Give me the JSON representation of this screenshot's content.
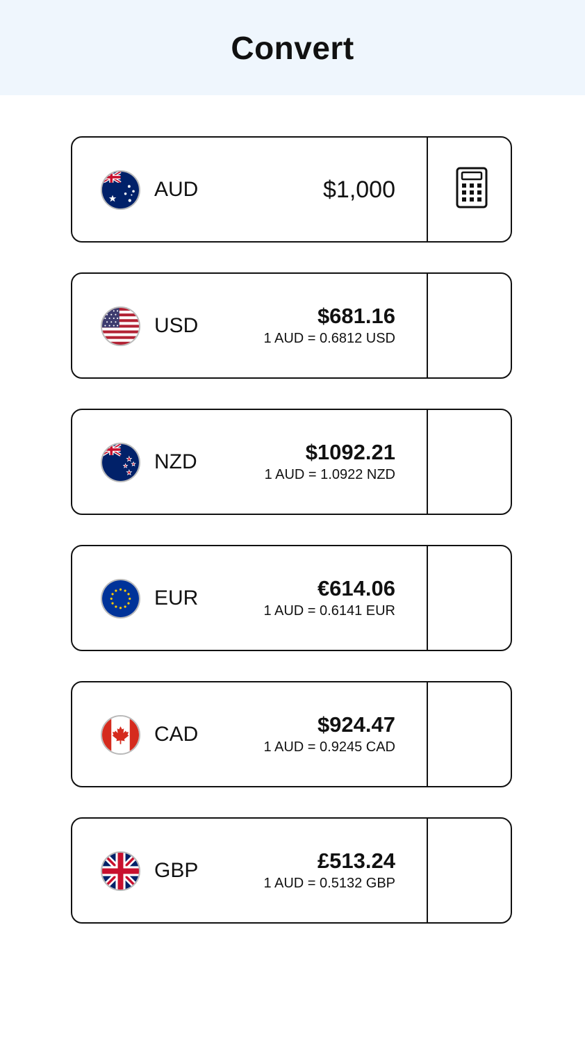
{
  "header": {
    "title": "Convert"
  },
  "base": {
    "code": "AUD",
    "amount": "$1,000",
    "flag_icon": "australia-flag-icon",
    "action_icon": "calculator-icon"
  },
  "conversions": [
    {
      "code": "USD",
      "amount": "$681.16",
      "rate": "1 AUD = 0.6812 USD",
      "flag_icon": "usa-flag-icon"
    },
    {
      "code": "NZD",
      "amount": "$1092.21",
      "rate": "1 AUD = 1.0922 NZD",
      "flag_icon": "new-zealand-flag-icon"
    },
    {
      "code": "EUR",
      "amount": "€614.06",
      "rate": "1 AUD = 0.6141 EUR",
      "flag_icon": "eu-flag-icon"
    },
    {
      "code": "CAD",
      "amount": "$924.47",
      "rate": "1 AUD = 0.9245 CAD",
      "flag_icon": "canada-flag-icon"
    },
    {
      "code": "GBP",
      "amount": "£513.24",
      "rate": "1 AUD = 0.5132 GBP",
      "flag_icon": "uk-flag-icon"
    }
  ]
}
